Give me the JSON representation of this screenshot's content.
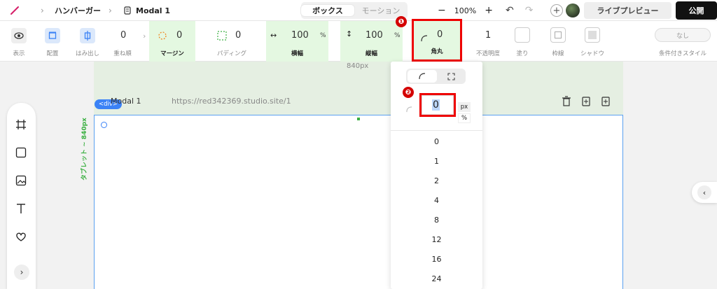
{
  "topbar": {
    "breadcrumb": [
      "ハンバーガー",
      "Modal 1"
    ],
    "tabs": [
      {
        "label": "ボックス",
        "active": true
      },
      {
        "label": "モーション",
        "active": false
      }
    ],
    "zoom": "100%",
    "zoom_minus": "−",
    "zoom_plus": "+",
    "preview_label": "ライブプレビュー",
    "publish_label": "公開"
  },
  "toolbar": {
    "display_label": "表示",
    "placement_label": "配置",
    "overflow_label": "はみ出し",
    "z_value": "0",
    "z_label": "重ね順",
    "margin_value": "0",
    "margin_label": "マージン",
    "padding_value": "0",
    "padding_label": "パディング",
    "width_value": "100",
    "width_unit": "%",
    "width_label": "横幅",
    "height_value": "100",
    "height_unit": "%",
    "height_label": "縦幅",
    "radius_value": "0",
    "radius_label": "角丸",
    "opacity_value": "1",
    "opacity_label": "不透明度",
    "fill_label": "塗り",
    "border_label": "枠線",
    "shadow_label": "シャドウ",
    "conditional_value": "なし",
    "conditional_label": "条件付きスタイル"
  },
  "canvas": {
    "ruler": "840px",
    "tag_badge": "<div>",
    "frame_title": "Modal 1",
    "frame_url": "https://red342369.studio.site/1",
    "breakpoint_label": "タブレット ~ 840px"
  },
  "radius_dropdown": {
    "input_value": "0",
    "unit_px": "px",
    "unit_percent": "%",
    "options": [
      "0",
      "1",
      "2",
      "4",
      "8",
      "12",
      "16",
      "24"
    ]
  },
  "annotations": [
    "❶",
    "❷"
  ],
  "colors": {
    "accent_green": "#e4f8e1",
    "highlight_red": "#e00000",
    "selection_blue": "#3b82f6",
    "publish": "#111111"
  }
}
